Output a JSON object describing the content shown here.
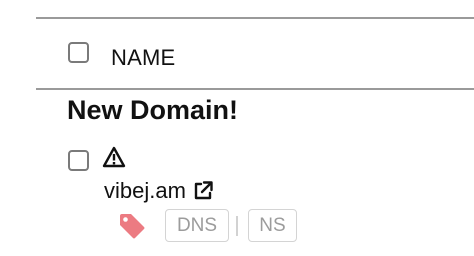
{
  "table": {
    "header": {
      "name_label": "NAME"
    },
    "group": {
      "title": "New Domain!"
    },
    "row": {
      "domain": "vibej.am",
      "chips": {
        "dns": "DNS",
        "ns": "NS"
      }
    }
  },
  "icons": {
    "warning": "warning-triangle-icon",
    "external_link": "external-link-icon",
    "tag": "tag-icon"
  },
  "colors": {
    "tag": "#ec7b82",
    "rule": "#9a9a9a",
    "chip_text": "#9c9c9c"
  }
}
